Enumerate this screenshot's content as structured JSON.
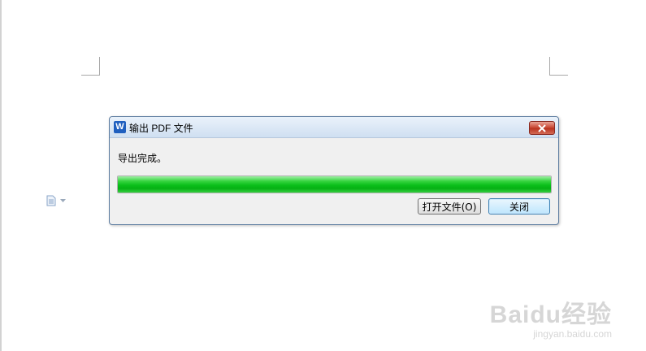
{
  "dialog": {
    "title": "输出 PDF 文件",
    "app_icon_letter": "W",
    "message": "导出完成。",
    "progress_percent": 100,
    "buttons": {
      "open": "打开文件(O)",
      "close": "关闭"
    }
  },
  "watermark": {
    "brand": "Baidu经验",
    "url": "jingyan.baidu.com"
  },
  "colors": {
    "progress_fill": "#0bbf1a",
    "title_bar": "#cfdff1",
    "close_button": "#c8432f",
    "app_icon": "#1f5fbf"
  }
}
